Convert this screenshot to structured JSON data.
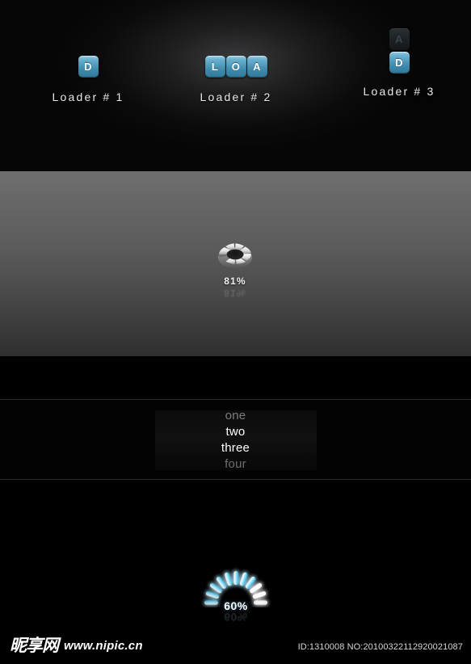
{
  "hero": {
    "loaders": [
      {
        "id": "loader-1",
        "caption": "Loader # 1",
        "tiles": [
          {
            "letter": "D",
            "state": "active"
          }
        ]
      },
      {
        "id": "loader-2",
        "caption": "Loader # 2",
        "tiles": [
          {
            "letter": "L",
            "state": "active"
          },
          {
            "letter": "O",
            "state": "active"
          },
          {
            "letter": "A",
            "state": "active"
          }
        ]
      },
      {
        "id": "loader-3",
        "caption": "Loader # 3",
        "tiles": [
          {
            "letter": "A",
            "state": "dim"
          },
          {
            "letter": "D",
            "state": "active"
          }
        ]
      }
    ],
    "tile_color_active": "#3f8cae",
    "tile_color_dim": "#1d2225"
  },
  "donut_loader": {
    "percent_label": "81%",
    "percent_value": 81,
    "reflection_label": "81%",
    "segments": 8,
    "segments_filled": 7,
    "ring_color": "#e8e8e8",
    "ring_color_dark": "#7d7d7d",
    "band_background": "#5c5c5c"
  },
  "word_list": {
    "items": [
      {
        "text": "one",
        "opacity": 0.45
      },
      {
        "text": "two",
        "opacity": 1.0
      },
      {
        "text": "three",
        "opacity": 1.0
      },
      {
        "text": "four",
        "opacity": 0.4
      }
    ]
  },
  "arc_loader": {
    "percent_label": "60%",
    "percent_value": 60,
    "reflection_label": "60%",
    "bars_total": 11,
    "bars_lit": 11,
    "glow_color": "#46d5ff",
    "bar_color": "#ffffff"
  },
  "footer": {
    "brand_cjk": "昵享网",
    "brand_url": "www.nipic.cn",
    "id_text": "ID:1310008 NO:20100322112920021087"
  }
}
